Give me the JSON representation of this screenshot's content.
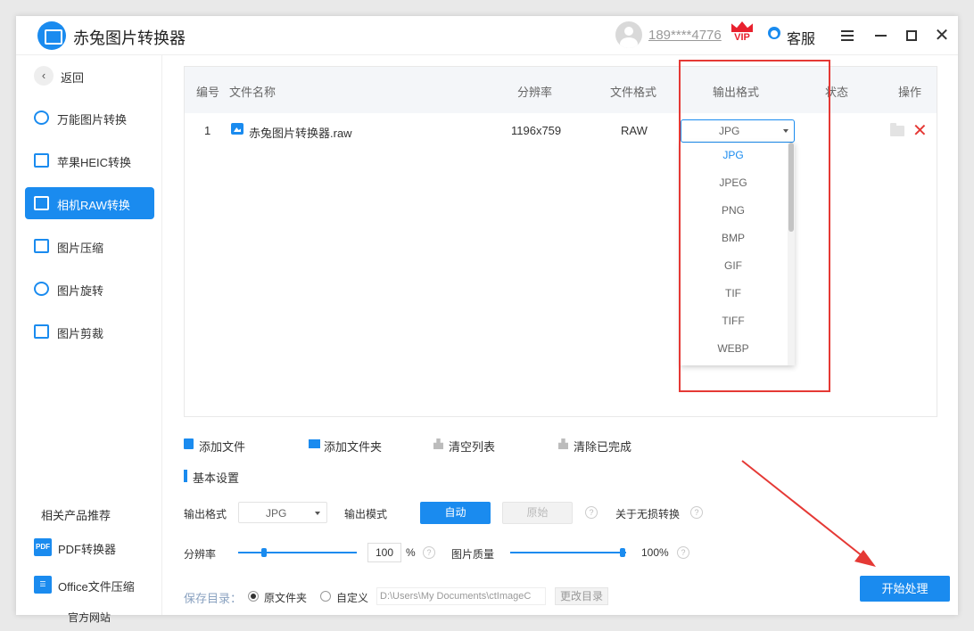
{
  "app": {
    "title": "赤兔图片转换器",
    "user_phone": "189****4776",
    "vip_label": "VIP",
    "service_label": "客服"
  },
  "sidebar": {
    "back_label": "返回",
    "items": [
      {
        "label": "万能图片转换"
      },
      {
        "label": "苹果HEIC转换"
      },
      {
        "label": "相机RAW转换"
      },
      {
        "label": "图片压缩"
      },
      {
        "label": "图片旋转"
      },
      {
        "label": "图片剪裁"
      }
    ],
    "related_title": "相关产品推荐",
    "related": [
      {
        "icon_text": "PDF",
        "label": "PDF转换器"
      },
      {
        "icon_text": "",
        "label": "Office文件压缩"
      }
    ],
    "official_site": "官方网站"
  },
  "table": {
    "headers": {
      "num": "编号",
      "name": "文件名称",
      "resolution": "分辨率",
      "format": "文件格式",
      "output": "输出格式",
      "status": "状态",
      "action": "操作"
    },
    "row": {
      "num": "1",
      "name": "赤兔图片转换器.raw",
      "resolution": "1196x759",
      "format": "RAW",
      "output": "JPG"
    }
  },
  "dropdown": {
    "options": [
      "JPG",
      "JPEG",
      "PNG",
      "BMP",
      "GIF",
      "TIF",
      "TIFF",
      "WEBP"
    ],
    "selected": "JPG"
  },
  "toolbar": {
    "add_file": "添加文件",
    "add_folder": "添加文件夹",
    "clear_list": "清空列表",
    "clear_done": "清除已完成"
  },
  "settings": {
    "section_title": "基本设置",
    "output_format_label": "输出格式",
    "output_format_value": "JPG",
    "output_mode_label": "输出模式",
    "mode_auto": "自动",
    "mode_original": "原始",
    "lossless_label": "关于无损转换",
    "resolution_label": "分辨率",
    "resolution_value": "100",
    "resolution_unit": "%",
    "quality_label": "图片质量",
    "quality_value": "100%",
    "save_dir_label": "保存目录：",
    "radio_original": "原文件夹",
    "radio_custom": "自定义",
    "path_value": "D:\\Users\\My Documents\\ctImageC",
    "change_dir": "更改目录",
    "start_button": "开始处理"
  },
  "colors": {
    "accent": "#1a8bef",
    "highlight_frame": "#e53935"
  }
}
